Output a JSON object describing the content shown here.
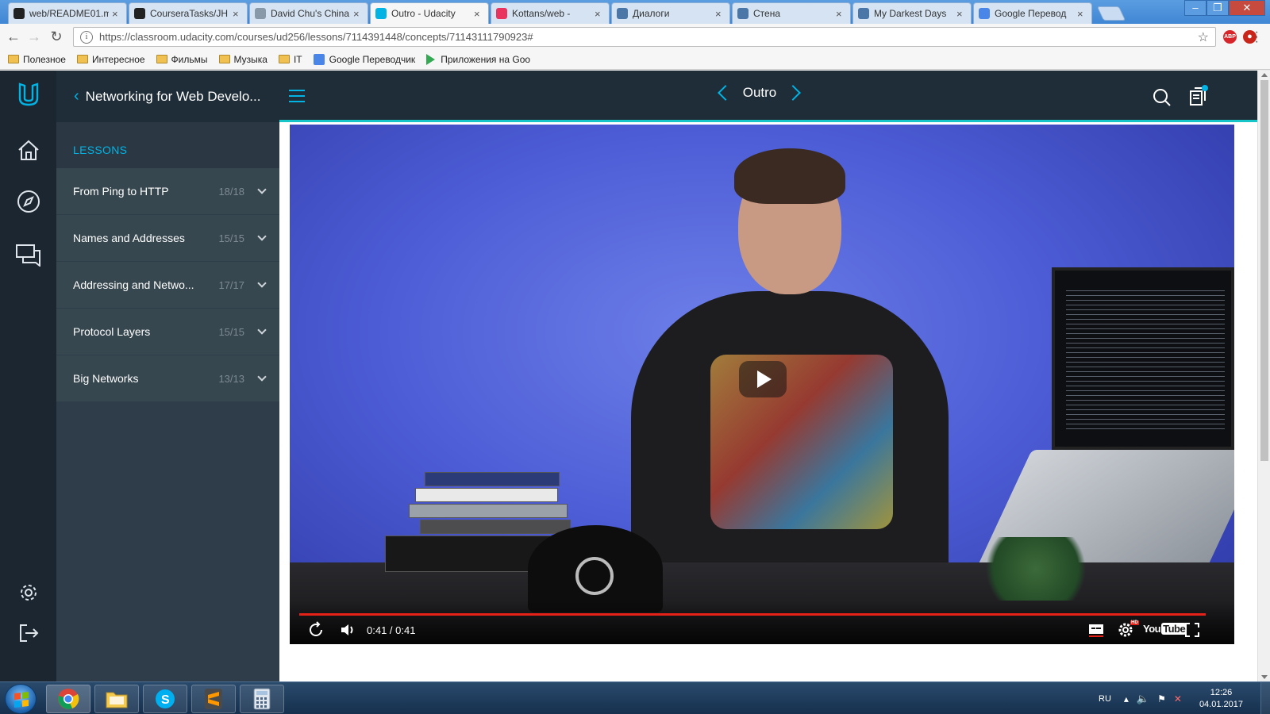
{
  "browser": {
    "tabs": [
      {
        "title": "web/README01.m",
        "favicon": "github-icon",
        "color": "#222222"
      },
      {
        "title": "CourseraTasks/JH",
        "favicon": "github-icon",
        "color": "#222222"
      },
      {
        "title": "David Chu's China",
        "favicon": "page-icon",
        "color": "#8899aa"
      },
      {
        "title": "Outro - Udacity",
        "favicon": "udacity-icon",
        "color": "#02b3e4",
        "active": true
      },
      {
        "title": "Kottans/web -",
        "favicon": "gitter-icon",
        "color": "#e8345e"
      },
      {
        "title": "Диалоги",
        "favicon": "vk-icon",
        "color": "#4a76a8"
      },
      {
        "title": "Стена",
        "favicon": "vk-icon",
        "color": "#4a76a8"
      },
      {
        "title": "My Darkest Days",
        "favicon": "vk-icon",
        "color": "#4a76a8"
      },
      {
        "title": "Google Перевод",
        "favicon": "google-translate-icon",
        "color": "#4a86e8"
      }
    ],
    "url": "https://classroom.udacity.com/courses/ud256/lessons/7114391448/concepts/71143111790923#",
    "bookmarks": [
      {
        "label": "Полезное",
        "type": "folder"
      },
      {
        "label": "Интересное",
        "type": "folder"
      },
      {
        "label": "Фильмы",
        "type": "folder"
      },
      {
        "label": "Музыка",
        "type": "folder"
      },
      {
        "label": "IT",
        "type": "folder"
      },
      {
        "label": "Google Переводчик",
        "type": "translate"
      },
      {
        "label": "Приложения на Goo",
        "type": "play"
      }
    ],
    "extensions": {
      "abp": "ABP"
    }
  },
  "udacity": {
    "course_title": "Networking for Web Develo...",
    "lessons_header": "LESSONS",
    "lessons": [
      {
        "name": "From Ping to HTTP",
        "count": "18/18"
      },
      {
        "name": "Names and Addresses",
        "count": "15/15"
      },
      {
        "name": "Addressing and Netwo...",
        "count": "17/17"
      },
      {
        "name": "Protocol Layers",
        "count": "15/15"
      },
      {
        "name": "Big Networks",
        "count": "13/13"
      }
    ],
    "concept_title": "Outro",
    "accent_color": "#02b3e4"
  },
  "video": {
    "time": "0:41 / 0:41",
    "progress_fraction": 1.0,
    "youtube_label": "You",
    "youtube_tube": "Tube",
    "hd_badge": "HD"
  },
  "taskbar": {
    "language": "RU",
    "time": "12:26",
    "date": "04.01.2017"
  }
}
